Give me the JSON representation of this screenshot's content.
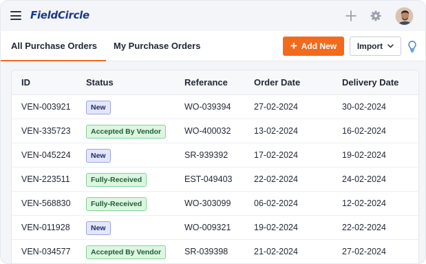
{
  "app": {
    "logo": "FieldCircle"
  },
  "tabs": [
    {
      "label": "All Purchase Orders",
      "active": true
    },
    {
      "label": "My Purchase Orders",
      "active": false
    }
  ],
  "toolbar": {
    "add_label": "Add New",
    "import_label": "Import"
  },
  "colors": {
    "accent": "#f26b1d",
    "brand": "#1a3a8a"
  },
  "table": {
    "columns": [
      "ID",
      "Status",
      "Referance",
      "Order Date",
      "Delivery Date"
    ],
    "rows": [
      {
        "id": "VEN-003921",
        "status": "New",
        "status_type": "new",
        "ref": "WO-039394",
        "order": "27-02-2024",
        "delivery": "30-02-2024"
      },
      {
        "id": "VEN-335723",
        "status": "Accepted By Vendor",
        "status_type": "accepted",
        "ref": "WO-400032",
        "order": "13-02-2024",
        "delivery": "16-02-2024"
      },
      {
        "id": "VEN-045224",
        "status": "New",
        "status_type": "new",
        "ref": "SR-939392",
        "order": "17-02-2024",
        "delivery": "19-02-2024"
      },
      {
        "id": "VEN-223511",
        "status": "Fully-Received",
        "status_type": "received",
        "ref": "EST-049403",
        "order": "22-02-2024",
        "delivery": "24-02-2024"
      },
      {
        "id": "VEN-568830",
        "status": "Fully-Received",
        "status_type": "received",
        "ref": "WO-303099",
        "order": "06-02-2024",
        "delivery": "12-02-2024"
      },
      {
        "id": "VEN-011928",
        "status": "New",
        "status_type": "new",
        "ref": "WO-009321",
        "order": "19-02-2024",
        "delivery": "22-02-2024"
      },
      {
        "id": "VEN-034577",
        "status": "Accepted By Vendor",
        "status_type": "accepted",
        "ref": "SR-039398",
        "order": "21-02-2024",
        "delivery": "27-02-2024"
      }
    ]
  }
}
